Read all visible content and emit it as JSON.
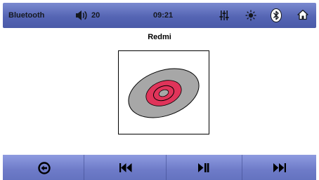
{
  "status": {
    "source": "Bluetooth",
    "volume": "20",
    "time": "09:21"
  },
  "track": {
    "title": "Redmi"
  },
  "colors": {
    "bar_top": "#5565b4",
    "bar_bottom": "#6e7bc8",
    "disc_grey": "#a7a7a7",
    "disc_red": "#e0345a"
  },
  "icons": {
    "status": [
      "speaker-icon",
      "equalizer-icon",
      "brightness-icon",
      "bluetooth-icon",
      "home-icon"
    ],
    "controls": [
      "back-icon",
      "previous-track-icon",
      "play-pause-icon",
      "next-track-icon"
    ]
  }
}
